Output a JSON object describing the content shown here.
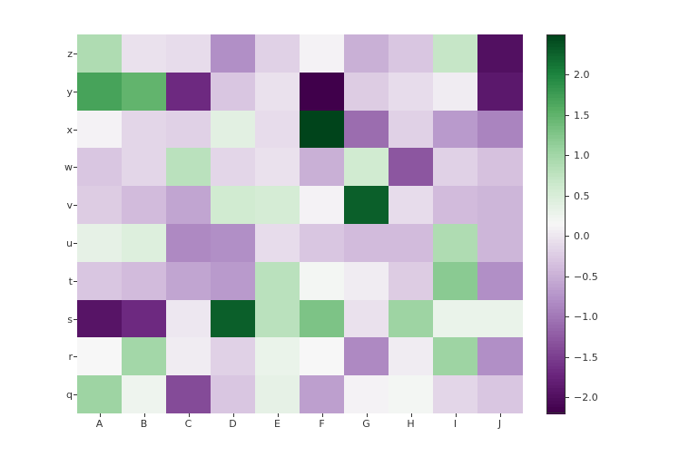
{
  "chart_data": {
    "type": "heatmap",
    "title": "",
    "xlabel": "",
    "ylabel": "",
    "columns": [
      "A",
      "B",
      "C",
      "D",
      "E",
      "F",
      "G",
      "H",
      "I",
      "J"
    ],
    "rows": [
      "z",
      "y",
      "x",
      "w",
      "v",
      "u",
      "t",
      "s",
      "r",
      "q"
    ],
    "grid": [
      [
        0.9,
        -0.05,
        -0.1,
        -0.8,
        -0.2,
        0.1,
        -0.5,
        -0.3,
        0.7,
        -2.0
      ],
      [
        1.7,
        1.5,
        -1.7,
        -0.3,
        -0.05,
        -2.2,
        -0.25,
        -0.1,
        0.05,
        -1.9
      ],
      [
        0.1,
        -0.15,
        -0.2,
        0.4,
        -0.1,
        2.5,
        -1.1,
        -0.2,
        -0.7,
        -0.9
      ],
      [
        -0.3,
        -0.15,
        0.8,
        -0.15,
        -0.05,
        -0.5,
        0.6,
        -1.3,
        -0.2,
        -0.35
      ],
      [
        -0.25,
        -0.4,
        -0.6,
        0.6,
        0.55,
        0.1,
        2.3,
        -0.1,
        -0.4,
        -0.45
      ],
      [
        0.35,
        0.45,
        -0.85,
        -0.8,
        -0.1,
        -0.3,
        -0.4,
        -0.4,
        0.9,
        -0.45
      ],
      [
        -0.3,
        -0.4,
        -0.6,
        -0.7,
        0.8,
        0.2,
        0.05,
        -0.25,
        1.2,
        -0.8
      ],
      [
        -1.95,
        -1.7,
        0.0,
        2.3,
        0.8,
        1.3,
        -0.05,
        1.05,
        0.3,
        0.3
      ],
      [
        0.15,
        1.0,
        0.05,
        -0.2,
        0.3,
        0.15,
        -0.85,
        0.05,
        1.05,
        -0.8
      ],
      [
        1.05,
        0.25,
        -1.4,
        -0.3,
        0.35,
        -0.65,
        0.1,
        0.2,
        -0.15,
        -0.3
      ]
    ],
    "vmin": -2.2,
    "vmax": 2.5,
    "colorscale": "PRGn"
  },
  "colorbar_ticks": [
    {
      "v": -2.0,
      "label": "−2.0"
    },
    {
      "v": -1.5,
      "label": "−1.5"
    },
    {
      "v": -1.0,
      "label": "−1.0"
    },
    {
      "v": -0.5,
      "label": "−0.5"
    },
    {
      "v": 0.0,
      "label": "0.0"
    },
    {
      "v": 0.5,
      "label": "0.5"
    },
    {
      "v": 1.0,
      "label": "1.0"
    },
    {
      "v": 1.5,
      "label": "1.5"
    },
    {
      "v": 2.0,
      "label": "2.0"
    }
  ]
}
